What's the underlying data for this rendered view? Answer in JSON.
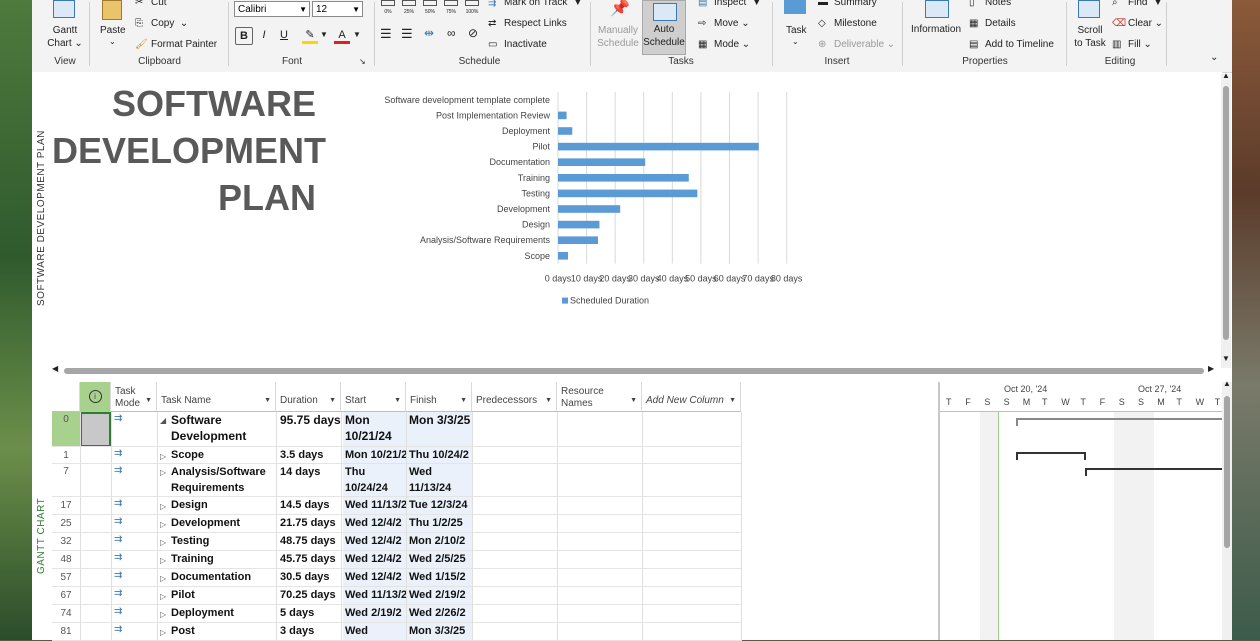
{
  "ribbon": {
    "view": {
      "gantt_chart": "Gantt Chart",
      "label": "View"
    },
    "clipboard": {
      "paste": "Paste",
      "cut": "Cut",
      "copy": "Copy",
      "format_painter": "Format Painter",
      "label": "Clipboard"
    },
    "font": {
      "family": "Calibri",
      "size": "12",
      "bold": "B",
      "italic": "I",
      "underline": "U",
      "label": "Font"
    },
    "schedule": {
      "mark_on_track": "Mark on Track",
      "respect_links": "Respect Links",
      "inactivate": "Inactivate",
      "label": "Schedule",
      "pct": [
        "0%",
        "25%",
        "50%",
        "75%",
        "100%"
      ]
    },
    "tasks": {
      "manually": "Manually Schedule",
      "auto": "Auto Schedule",
      "inspect": "Inspect",
      "move": "Move",
      "mode": "Mode",
      "label": "Tasks"
    },
    "insert": {
      "task": "Task",
      "summary": "Summary",
      "milestone": "Milestone",
      "deliverable": "Deliverable",
      "label": "Insert"
    },
    "properties": {
      "information": "Information",
      "notes": "Notes",
      "details": "Details",
      "add_to_timeline": "Add to Timeline",
      "label": "Properties"
    },
    "editing": {
      "scroll_to_task": "Scroll to Task",
      "find": "Find",
      "clear": "Clear",
      "fill": "Fill",
      "label": "Editing"
    }
  },
  "report": {
    "side_label": "SOFTWARE DEVELOPMENT PLAN",
    "title_lines": [
      "SOFTWARE",
      "DEVELOPMENT",
      "PLAN"
    ]
  },
  "chart_data": {
    "type": "bar",
    "orientation": "horizontal",
    "categories": [
      "Software development template complete",
      "Post Implementation Review",
      "Deployment",
      "Pilot",
      "Documentation",
      "Training",
      "Testing",
      "Development",
      "Design",
      "Analysis/Software Requirements",
      "Scope"
    ],
    "values": [
      0,
      3,
      5,
      70.25,
      30.5,
      45.75,
      48.75,
      21.75,
      14.5,
      14,
      3.5
    ],
    "x_ticks": [
      "0 days",
      "10 days",
      "20 days",
      "30 days",
      "40 days",
      "50 days",
      "60 days",
      "70 days",
      "80 days"
    ],
    "xlim": [
      0,
      80
    ],
    "legend": "Scheduled Duration",
    "legend_position": "bottom",
    "grid": true,
    "color": "#5b9bd5"
  },
  "table": {
    "side_label": "GANTT CHART",
    "headers": {
      "task_mode": "Task Mode",
      "task_name": "Task Name",
      "duration": "Duration",
      "start": "Start",
      "finish": "Finish",
      "predecessors": "Predecessors",
      "resource_names": "Resource Names",
      "add_new_column": "Add New Column"
    },
    "rows": [
      {
        "id": "0",
        "name": "Software Development",
        "duration": "95.75 days",
        "start": "Mon 10/21/24",
        "finish": "Mon 3/3/25",
        "summary": true,
        "marker": "◢"
      },
      {
        "id": "1",
        "name": "Scope",
        "duration": "3.5 days",
        "start": "Mon 10/21/2",
        "finish": "Thu 10/24/2",
        "marker": "▷"
      },
      {
        "id": "7",
        "name": "Analysis/Software Requirements",
        "duration": "14 days",
        "start": "Thu 10/24/24",
        "finish": "Wed 11/13/24",
        "marker": "▷"
      },
      {
        "id": "17",
        "name": "Design",
        "duration": "14.5 days",
        "start": "Wed 11/13/2",
        "finish": "Tue 12/3/24",
        "marker": "▷"
      },
      {
        "id": "25",
        "name": "Development",
        "duration": "21.75 days",
        "start": "Wed 12/4/2",
        "finish": "Thu 1/2/25",
        "marker": "▷"
      },
      {
        "id": "32",
        "name": "Testing",
        "duration": "48.75 days",
        "start": "Wed 12/4/2",
        "finish": "Mon 2/10/2",
        "marker": "▷"
      },
      {
        "id": "48",
        "name": "Training",
        "duration": "45.75 days",
        "start": "Wed 12/4/2",
        "finish": "Wed 2/5/25",
        "marker": "▷"
      },
      {
        "id": "57",
        "name": "Documentation",
        "duration": "30.5 days",
        "start": "Wed 12/4/2",
        "finish": "Wed 1/15/2",
        "marker": "▷"
      },
      {
        "id": "67",
        "name": "Pilot",
        "duration": "70.25 days",
        "start": "Wed 11/13/2",
        "finish": "Wed 2/19/2",
        "marker": "▷"
      },
      {
        "id": "74",
        "name": "Deployment",
        "duration": "5 days",
        "start": "Wed 2/19/2",
        "finish": "Wed 2/26/2",
        "marker": "▷"
      },
      {
        "id": "81",
        "name": "Post",
        "duration": "3 days",
        "start": "Wed",
        "finish": "Mon 3/3/25",
        "marker": "▷"
      }
    ]
  },
  "gantt": {
    "weeks": [
      "Oct 20, '24",
      "Oct 27, '24"
    ],
    "days": [
      "T",
      "F",
      "S",
      "S",
      "M",
      "T",
      "W",
      "T",
      "F",
      "S",
      "S",
      "M",
      "T",
      "W",
      "T"
    ]
  }
}
